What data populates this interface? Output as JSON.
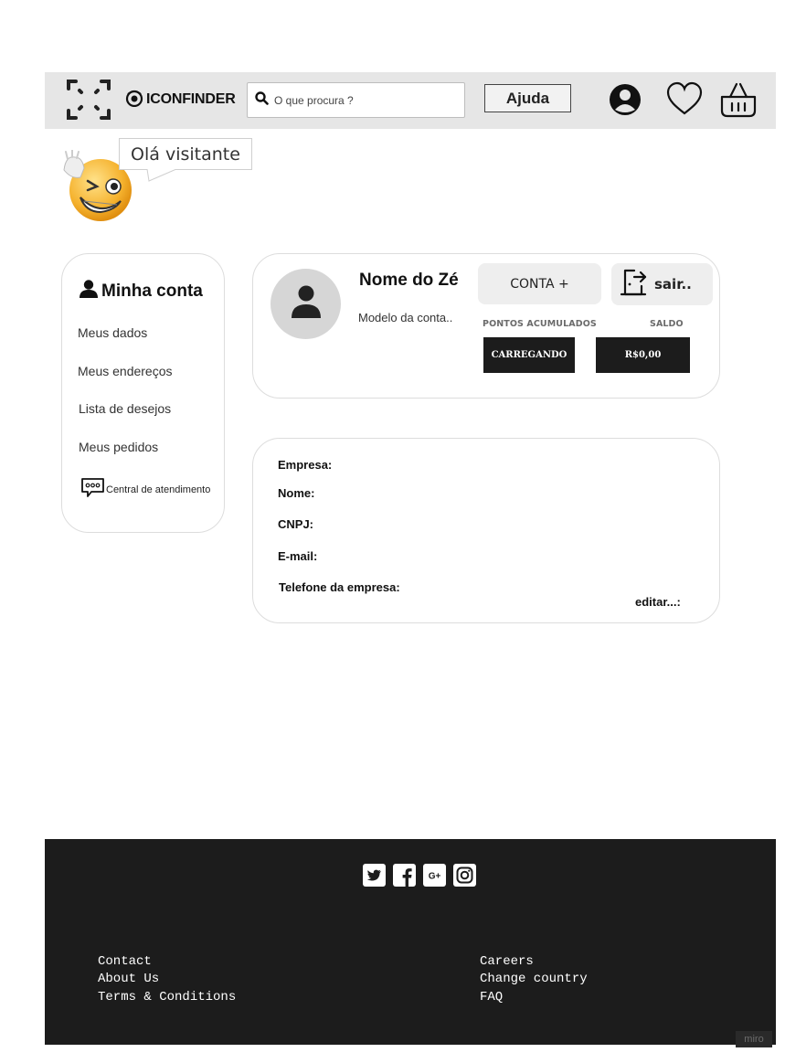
{
  "header": {
    "logo_text": "ICONFINDER",
    "search_placeholder": "O que procura ?",
    "help_label": "Ajuda"
  },
  "greeting": {
    "bubble_text": "Olá visitante"
  },
  "sidebar": {
    "title": "Minha conta",
    "items": [
      {
        "label": "Meus dados"
      },
      {
        "label": "Meus endereços"
      },
      {
        "label": "Lista de desejos"
      },
      {
        "label": "Meus pedidos"
      }
    ],
    "support_label": "Central de atendimento"
  },
  "profile": {
    "name": "Nome do Zé",
    "account_model": "Modelo da conta..",
    "conta_button": "CONTA +",
    "sair_button": "sair..",
    "points_label": "PONTOS ACUMULADOS",
    "points_value": "CARREGANDO",
    "balance_label": "SALDO",
    "balance_value": "R$0,00"
  },
  "company": {
    "fields": [
      {
        "label": "Empresa:"
      },
      {
        "label": "Nome:"
      },
      {
        "label": "CNPJ:"
      },
      {
        "label": "E-mail:"
      },
      {
        "label": "Telefone da empresa:"
      }
    ],
    "edit_label": "editar...:"
  },
  "footer": {
    "social_icons": [
      "twitter-icon",
      "facebook-icon",
      "google-plus-icon",
      "instagram-icon"
    ],
    "left_links": [
      "Contact",
      "About Us",
      "Terms & Conditions"
    ],
    "right_links": [
      "Careers",
      "Change country",
      "FAQ"
    ],
    "watermark": "miro"
  }
}
